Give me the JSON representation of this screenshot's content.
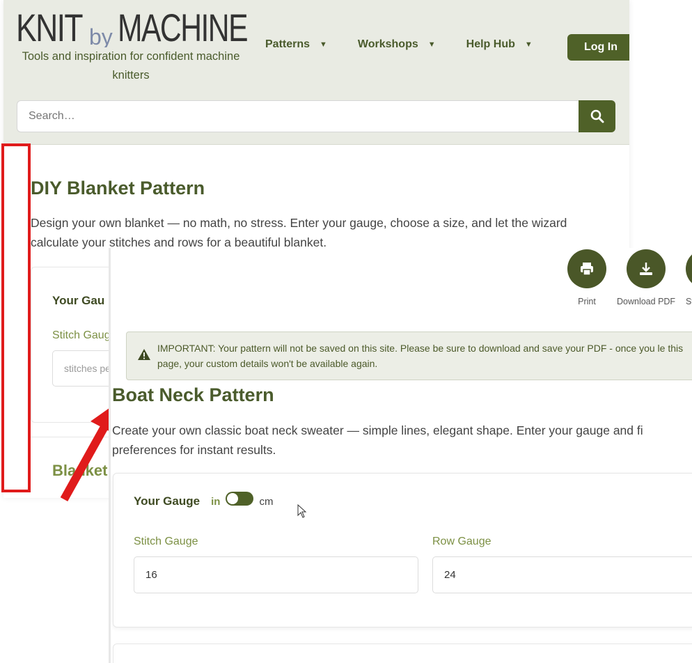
{
  "site": {
    "logo": {
      "word1": "KNIT",
      "word2": "by",
      "word3": "MACHINE"
    },
    "tagline": "Tools and inspiration for confident machine knitters",
    "nav": [
      {
        "label": "Patterns"
      },
      {
        "label": "Workshops"
      },
      {
        "label": "Help Hub"
      }
    ],
    "login_label": "Log In",
    "search_placeholder": "Search…"
  },
  "back_page": {
    "title": "DIY Blanket Pattern",
    "description": "Design your own blanket — no math, no stress. Enter your gauge, choose a size, and let the wizard calculate your stitches and rows for a beautiful blanket.",
    "gauge_title": "Your Gau",
    "stitch_label": "Stitch Gaug",
    "stitch_placeholder": "stitches pe",
    "section2_title": "Blanket"
  },
  "front_page": {
    "actions": [
      {
        "label": "Print",
        "icon": "print-icon"
      },
      {
        "label": "Download PDF",
        "icon": "download-icon"
      },
      {
        "label": "St",
        "icon": "share-icon"
      }
    ],
    "important_msg": "IMPORTANT: Your pattern will not be saved on this site. Please be sure to download and save your PDF - once you le this page, your custom details won't be available again.",
    "title": "Boat Neck Pattern",
    "description": "Create your own classic boat neck sweater — simple lines, elegant shape. Enter your gauge and fi preferences for instant results.",
    "gauge_title": "Your Gauge",
    "unit_in": "in",
    "unit_cm": "cm",
    "stitch_label": "Stitch Gauge",
    "stitch_value": "16",
    "row_label": "Row Gauge",
    "row_value": "24"
  },
  "colors": {
    "brand": "#4f6128",
    "header_bg": "#e9ebe3",
    "accent_light": "#7c9044",
    "annotation": "#e01b1b"
  }
}
